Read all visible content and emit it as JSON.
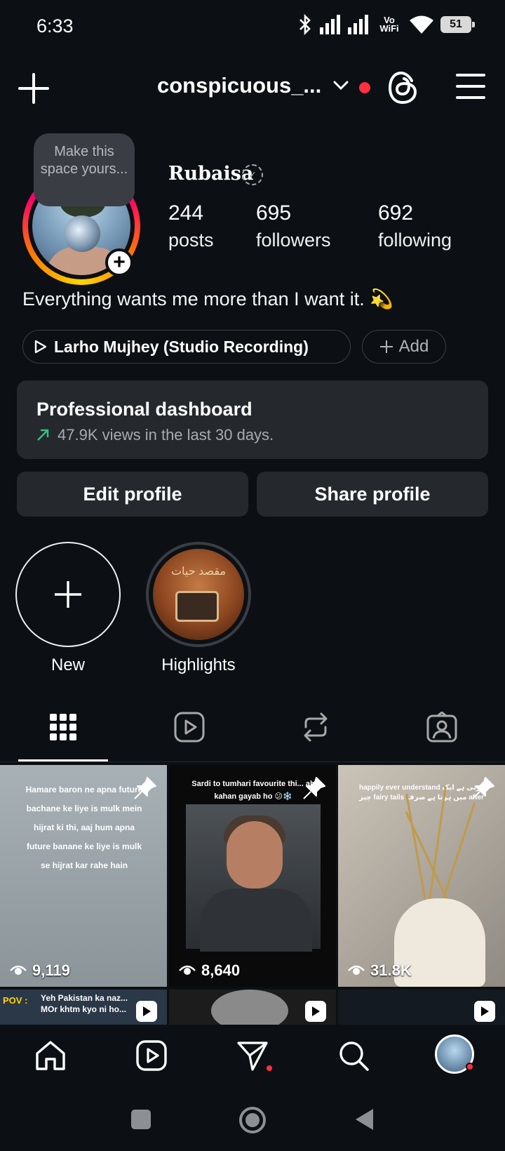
{
  "status_bar": {
    "time": "6:33",
    "network_label": "Vo WiFi",
    "battery": "51"
  },
  "header": {
    "username": "conspicuous_..."
  },
  "profile": {
    "tooltip": "Make this space yours...",
    "display_name": "Rubaisa",
    "stats": [
      {
        "value": "244",
        "label": "posts"
      },
      {
        "value": "695",
        "label": "followers"
      },
      {
        "value": "692",
        "label": "following"
      }
    ],
    "bio": "Everything wants me more than I want it. 💫",
    "music": "Larho Mujhey (Studio Recording)",
    "add_label": "Add"
  },
  "dashboard": {
    "title": "Professional dashboard",
    "subtitle": "47.9K views in the last 30 days."
  },
  "buttons": {
    "edit": "Edit profile",
    "share": "Share profile"
  },
  "highlights": [
    {
      "label": "New"
    },
    {
      "label": "Highlights",
      "cover_text": "مقصد حیات"
    }
  ],
  "tabs": [
    "grid-icon",
    "reels-icon",
    "reposts-icon",
    "tagged-icon"
  ],
  "posts": [
    {
      "views": "9,119",
      "caption": "Hamare baron ne apna future bachane ke liye is mulk mein hijrat ki thi, aaj hum apna future banane ke liye is mulk se hijrat kar rahe hain"
    },
    {
      "views": "8,640",
      "caption": "Sardi to tumhari favourite thi... ab kahan gayab ho 😕❄️"
    },
    {
      "views": "31.8K",
      "caption": "happily ever understand کرتی ہے ایک چیز fairy tails میں ہوتا ہے صرف after"
    }
  ],
  "posts_row2": [
    {
      "tag": "POV :",
      "caption": "Yeh Pakistan ka naz... MOr khtm kyo ni ho..."
    }
  ],
  "colors": {
    "background": "#0c1014",
    "surface": "#25292e",
    "accent_red": "#ff3040",
    "trend_green": "#35c17a"
  }
}
